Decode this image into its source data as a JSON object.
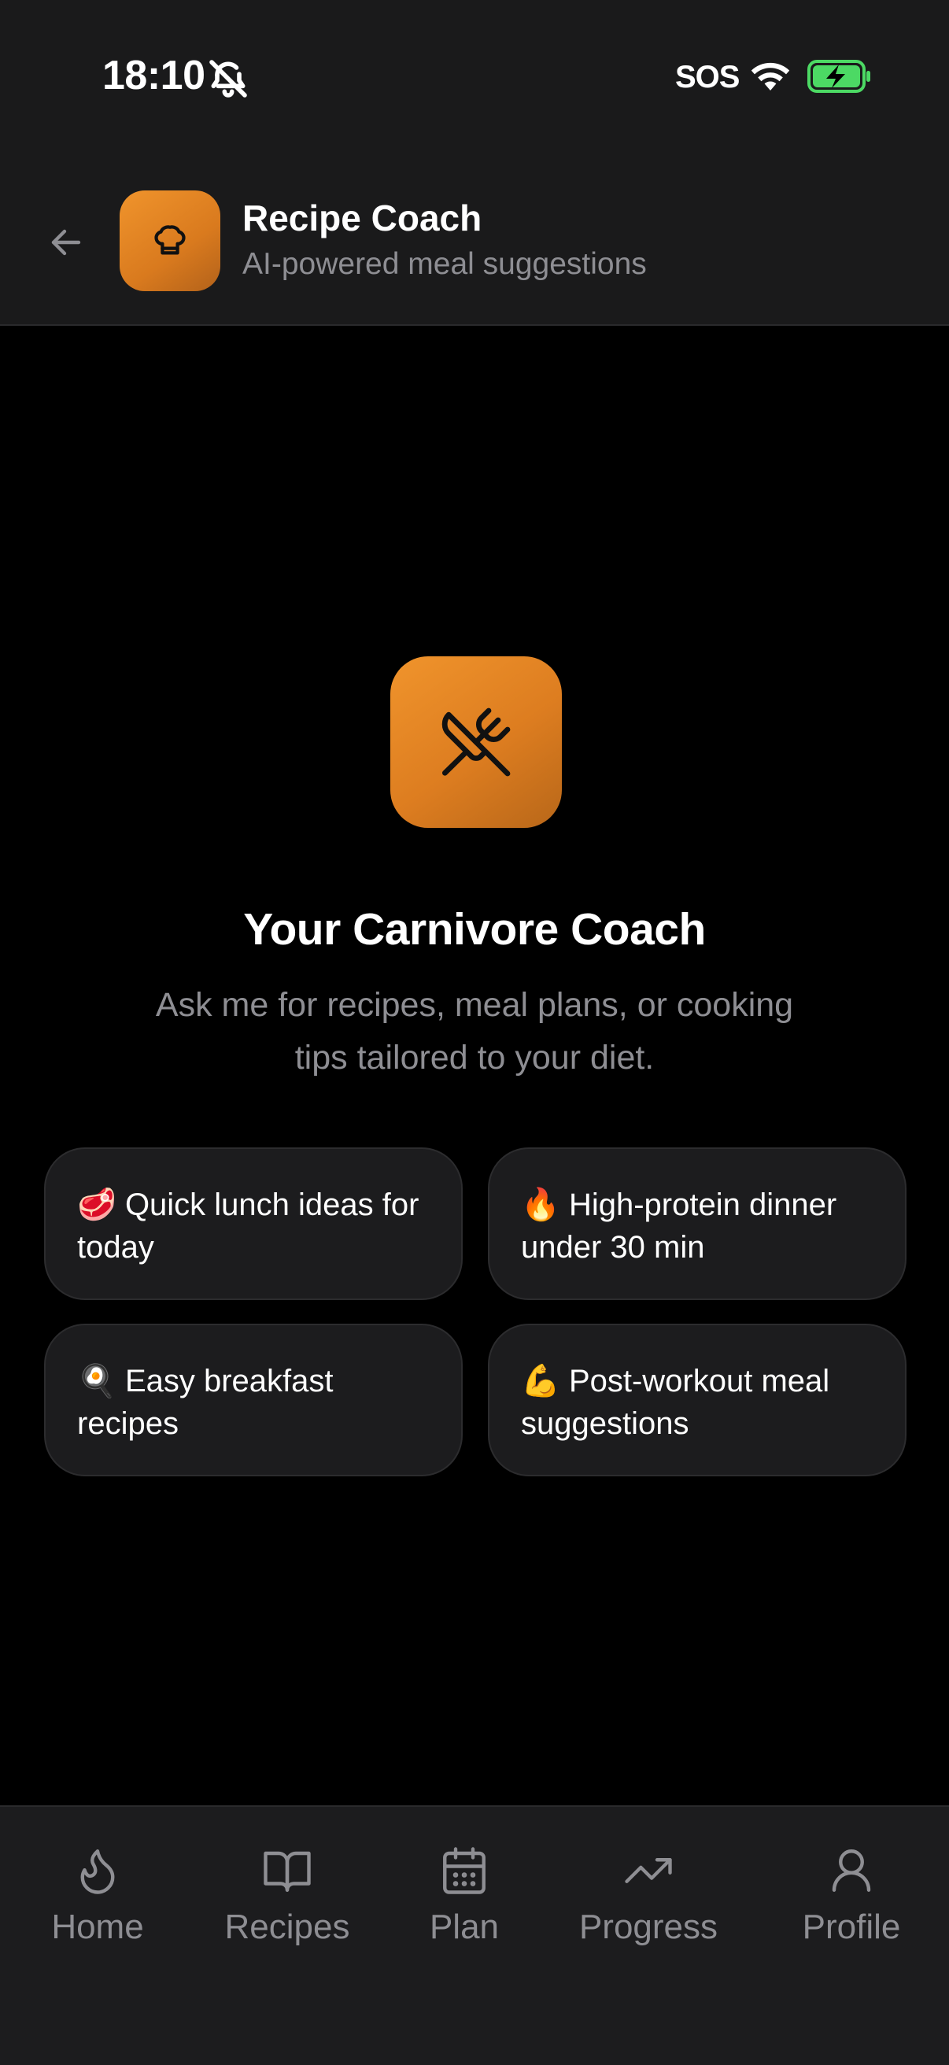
{
  "status_bar": {
    "time": "18:10",
    "carrier_text": "SOS",
    "icons": [
      "bell-slash-icon",
      "wifi-icon",
      "battery-charging-icon"
    ]
  },
  "header": {
    "title": "Recipe Coach",
    "subtitle": "AI-powered meal suggestions",
    "back_icon": "arrow-left-icon",
    "logo_icon": "chef-hat-icon"
  },
  "hero": {
    "icon": "utensils-crossed-icon",
    "title": "Your Carnivore Coach",
    "subtitle": "Ask me for recipes, meal plans, or cooking tips tailored to your diet."
  },
  "suggestions": [
    {
      "emoji": "🥩",
      "text": "Quick lunch ideas for today"
    },
    {
      "emoji": "🔥",
      "text": "High-protein dinner under 30 min"
    },
    {
      "emoji": "🍳",
      "text": "Easy breakfast recipes"
    },
    {
      "emoji": "💪",
      "text": "Post-workout meal suggestions"
    }
  ],
  "nav": {
    "items": [
      {
        "label": "Home",
        "icon": "flame-icon"
      },
      {
        "label": "Recipes",
        "icon": "book-open-icon"
      },
      {
        "label": "Plan",
        "icon": "calendar-icon"
      },
      {
        "label": "Progress",
        "icon": "trending-up-icon"
      },
      {
        "label": "Profile",
        "icon": "user-icon"
      }
    ]
  },
  "colors": {
    "accent": "#E8892A",
    "background": "#000000",
    "surface": "#1C1C1E",
    "muted_text": "#8E8E93",
    "battery_green": "#4CD964"
  }
}
